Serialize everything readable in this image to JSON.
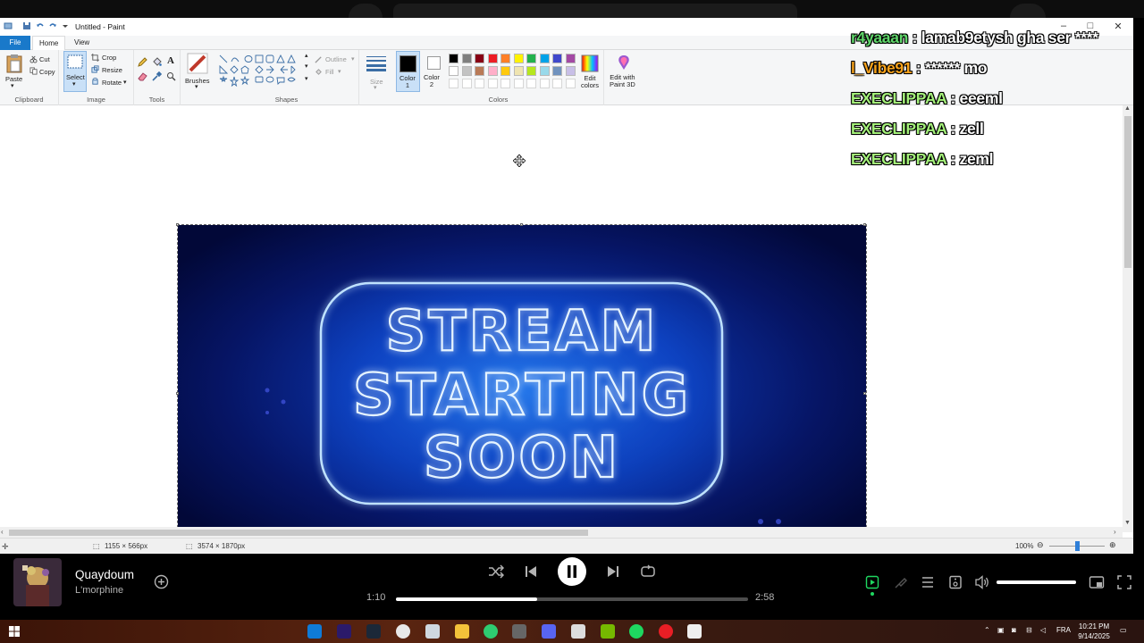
{
  "window": {
    "title": "Untitled - Paint",
    "controls": {
      "minimize": "–",
      "maximize": "□",
      "close": "✕"
    }
  },
  "ribbon_tabs": {
    "file": "File",
    "home": "Home",
    "view": "View"
  },
  "clipboard": {
    "paste": "Paste",
    "cut": "Cut",
    "copy": "Copy",
    "group": "Clipboard"
  },
  "image_group": {
    "select": "Select",
    "crop": "Crop",
    "resize": "Resize",
    "rotate": "Rotate",
    "group": "Image"
  },
  "tools_group": {
    "group": "Tools"
  },
  "brushes": {
    "label": "Brushes"
  },
  "shapes": {
    "outline": "Outline",
    "fill": "Fill",
    "group": "Shapes"
  },
  "size": {
    "label": "Size"
  },
  "colors": {
    "color1_label": "Color\n1",
    "color2_label": "Color\n2",
    "color1": "#000000",
    "color2": "#ffffff",
    "edit_colors": "Edit\ncolors",
    "group": "Colors",
    "palette_row1": [
      "#000000",
      "#7f7f7f",
      "#880015",
      "#ed1c24",
      "#ff7f27",
      "#fff200",
      "#22b14c",
      "#00a2e8",
      "#3f48cc",
      "#a349a4"
    ],
    "palette_row2": [
      "#ffffff",
      "#c3c3c3",
      "#b97a57",
      "#ffaec9",
      "#ffc90e",
      "#efe4b0",
      "#b5e61d",
      "#99d9ea",
      "#7092be",
      "#c8bfe7"
    ]
  },
  "paint3d": {
    "label": "Edit with\nPaint 3D"
  },
  "canvas_image": {
    "lines": [
      "STREAM",
      "STARTING",
      "SOON"
    ],
    "accent": "#3aa0ff"
  },
  "statusbar": {
    "selection_size": "1155 × 566px",
    "image_size": "3574 × 1870px",
    "zoom": "100%",
    "zoom_level": 0.5
  },
  "chat": [
    {
      "user": "r4yaaan",
      "sep": " : ",
      "message": "lamab9etysh gha ser ****",
      "color": "#5fd66a"
    },
    {
      "user": "l_Vibe91",
      "sep": " : ",
      "message": "****** mo",
      "color": "#f7a21b"
    },
    {
      "user": "EXECLIPPAA",
      "sep": " : ",
      "message": "eeeml",
      "color": "#a4f07a"
    },
    {
      "user": "EXECLIPPAA",
      "sep": " : ",
      "message": "zell",
      "color": "#a4f07a"
    },
    {
      "user": "EXECLIPPAA",
      "sep": " : ",
      "message": "zeml",
      "color": "#a4f07a"
    }
  ],
  "player": {
    "song": "Quaydoum",
    "artist": "L'morphine",
    "elapsed": "1:10",
    "duration": "2:58",
    "progress": 0.4,
    "volume": 1.0
  },
  "taskbar": {
    "language": "FRA",
    "time": "10:21 PM",
    "date": "9/14/2025",
    "apps": [
      "edge-app",
      "premiere-app",
      "steam-app",
      "chrome-app",
      "app-5",
      "explorer-app",
      "app-7",
      "app-8",
      "app-9",
      "app-10",
      "nvidia-app",
      "spotify-app",
      "opera-app",
      "app-14"
    ]
  }
}
